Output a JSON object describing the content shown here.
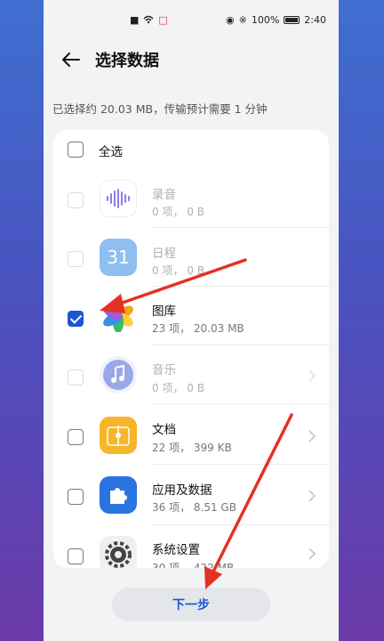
{
  "status_bar": {
    "battery": "100%",
    "time": "2:40"
  },
  "header": {
    "title": "选择数据"
  },
  "summary": "已选择约 20.03 MB，传输预计需要 1 分钟",
  "select_all": {
    "label": "全选"
  },
  "items": [
    {
      "name": "录音",
      "meta": "0 项， 0 B",
      "icon": "voice-recorder-icon",
      "checked": false,
      "enabled": false
    },
    {
      "name": "日程",
      "meta": "0 项， 0 B",
      "icon": "calendar-icon",
      "icon_text": "31",
      "checked": false,
      "enabled": false
    },
    {
      "name": "图库",
      "meta": "23 项， 20.03 MB",
      "icon": "gallery-icon",
      "checked": true,
      "enabled": true
    },
    {
      "name": "音乐",
      "meta": "0 项， 0 B",
      "icon": "music-icon",
      "checked": false,
      "enabled": false
    },
    {
      "name": "文档",
      "meta": "22 项， 399 KB",
      "icon": "documents-icon",
      "checked": false,
      "enabled": true
    },
    {
      "name": "应用及数据",
      "meta": "36 项， 8.51 GB",
      "icon": "apps-icon",
      "checked": false,
      "enabled": true
    },
    {
      "name": "系统设置",
      "meta": "30 项， 422 MB",
      "icon": "settings-icon",
      "checked": false,
      "enabled": true
    }
  ],
  "next_button": {
    "label": "下一步"
  },
  "colors": {
    "accent": "#1d57d0",
    "annotation_arrow": "#e53024"
  }
}
